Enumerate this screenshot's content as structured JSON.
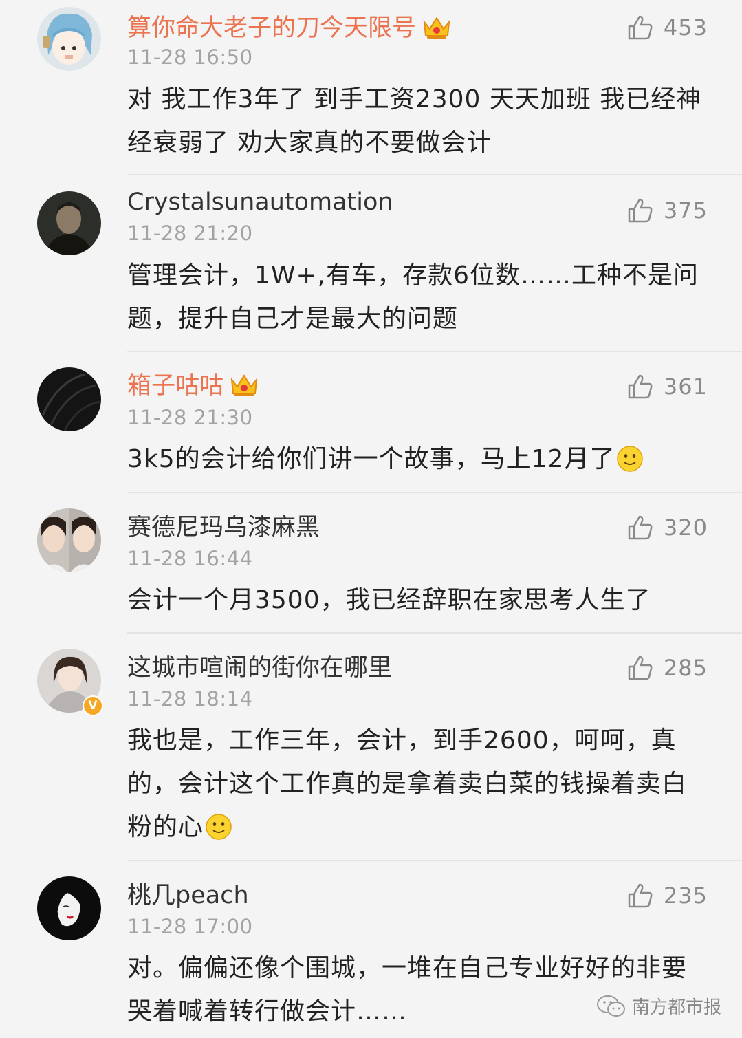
{
  "comments": [
    {
      "username": "算你命大老子的刀今天限号",
      "time": "11-28 16:50",
      "likes": "453",
      "text": "对 我工作3年了 到手工资2300 天天加班 我已经神经衰弱了 劝大家真的不要做会计",
      "vip": true
    },
    {
      "username": "Crystalsunautomation",
      "time": "11-28 21:20",
      "likes": "375",
      "text": "管理会计，1W+,有车，存款6位数……工种不是问题，提升自己才是最大的问题",
      "vip": false
    },
    {
      "username": "箱子咕咕",
      "time": "11-28 21:30",
      "likes": "361",
      "text": "3k5的会计给你们讲一个故事，马上12月了",
      "vip": true
    },
    {
      "username": "赛德尼玛乌漆麻黑",
      "time": "11-28 16:44",
      "likes": "320",
      "text": "会计一个月3500，我已经辞职在家思考人生了",
      "vip": false
    },
    {
      "username": "这城市喧闹的街你在哪里",
      "time": "11-28 18:14",
      "likes": "285",
      "text": "我也是，工作三年，会计，到手2600，呵呵，真的，会计这个工作真的是拿着卖白菜的钱操着卖白粉的心",
      "vip": false,
      "verified": true
    },
    {
      "username": "桃几peach",
      "time": "11-28 17:00",
      "likes": "235",
      "text": "对。偏偏还像个围城，一堆在自己专业好好的非要哭着喊着转行做会计……",
      "vip": false
    }
  ],
  "watermark": {
    "text": "南方都市报",
    "icon": "wechat-icon"
  },
  "colors": {
    "vip_name": "#eb7350",
    "time": "#a3a3a3",
    "background": "#f4f4f4"
  }
}
